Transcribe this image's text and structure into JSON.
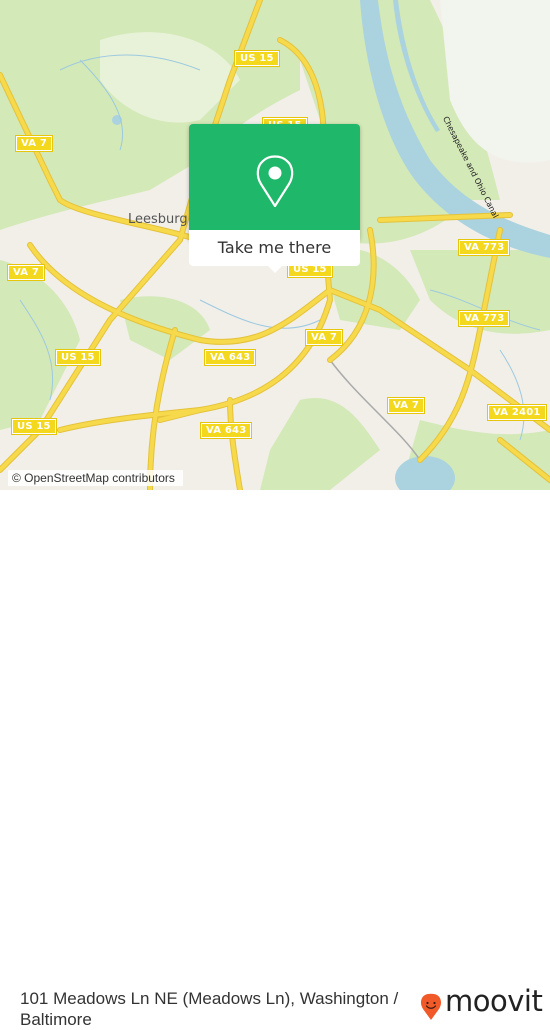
{
  "map": {
    "place_labels": {
      "leesburg": "Leesburg"
    },
    "water_labels": {
      "canal": "Chesapeake and Ohio Canal"
    },
    "route_shields": [
      {
        "id": "us15-north",
        "label": "US 15"
      },
      {
        "id": "us15-top-popup",
        "label": "US 15"
      },
      {
        "id": "va7-west-upper",
        "label": "VA 7"
      },
      {
        "id": "va7-west-lower",
        "label": "VA 7"
      },
      {
        "id": "us15-below-popup",
        "label": "US 15"
      },
      {
        "id": "va773-upper",
        "label": "VA 773"
      },
      {
        "id": "va773-lower",
        "label": "VA 773"
      },
      {
        "id": "va7-center",
        "label": "VA 7"
      },
      {
        "id": "us15-southwest-1",
        "label": "US 15"
      },
      {
        "id": "va643-upper",
        "label": "VA 643"
      },
      {
        "id": "va643-lower",
        "label": "VA 643"
      },
      {
        "id": "us15-southwest-2",
        "label": "US 15"
      },
      {
        "id": "va7-southeast",
        "label": "VA 7"
      },
      {
        "id": "va2401",
        "label": "VA 2401"
      }
    ],
    "attribution": "© OpenStreetMap contributors",
    "colors": {
      "land": "#f2efe9",
      "park": "#cfe8b0",
      "water": "#aad3df",
      "road": "#f7d94c",
      "road_casing": "#e4c23a"
    }
  },
  "popup": {
    "icon": "map-pin-icon",
    "button_label": "Take me there",
    "color": "#1fb76a"
  },
  "footer": {
    "address": "101 Meadows Ln NE (Meadows Ln), Washington / Baltimore",
    "brand": "moovit",
    "brand_icon_color": "#f05a28"
  }
}
